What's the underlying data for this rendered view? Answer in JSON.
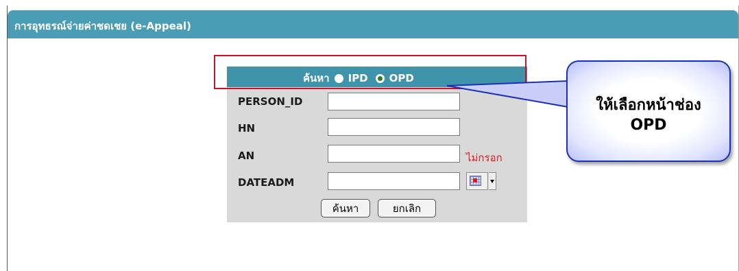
{
  "window": {
    "title": "การอุทธรณ์จ่ายค่าชดเชย (e-Appeal)"
  },
  "search": {
    "header_label": "ค้นหา",
    "options": [
      {
        "label": "IPD",
        "checked": false
      },
      {
        "label": "OPD",
        "checked": true
      }
    ],
    "fields": [
      {
        "label": "PERSON_ID",
        "value": ""
      },
      {
        "label": "HN",
        "value": ""
      },
      {
        "label": "AN",
        "value": "",
        "note": "ไม่กรอก"
      },
      {
        "label": "DATEADM",
        "value": ""
      }
    ],
    "search_button": "ค้นหา",
    "cancel_button": "ยกเลิก",
    "calendar_icon": "calendar-icon",
    "note_color": "#e01b24"
  },
  "callout": {
    "line1": "ให้เลือกหน้าช่อง",
    "line2": "OPD"
  },
  "colors": {
    "titlebar": "#4a9db5",
    "panel_header": "#3f93aa",
    "panel_bg": "#d9d9d9",
    "highlight_box": "#c0152a",
    "callout_border": "#1c2fb8"
  }
}
